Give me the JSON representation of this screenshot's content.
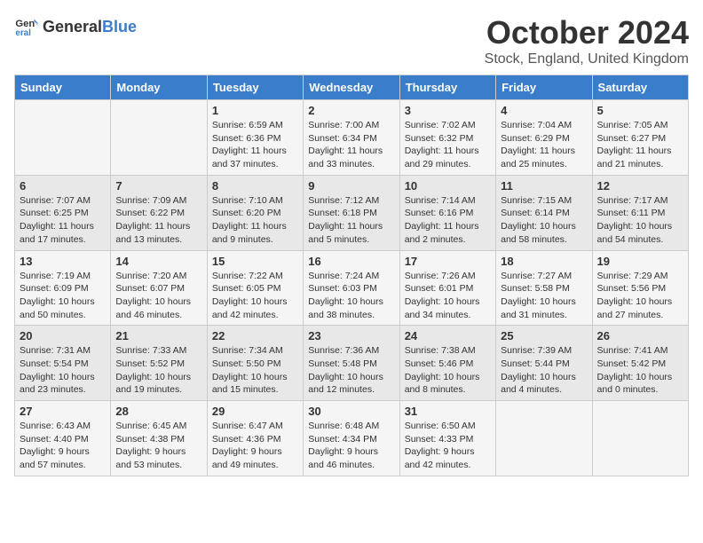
{
  "header": {
    "logo_general": "General",
    "logo_blue": "Blue",
    "month_title": "October 2024",
    "location": "Stock, England, United Kingdom"
  },
  "weekdays": [
    "Sunday",
    "Monday",
    "Tuesday",
    "Wednesday",
    "Thursday",
    "Friday",
    "Saturday"
  ],
  "weeks": [
    [
      {
        "day": "",
        "info": ""
      },
      {
        "day": "",
        "info": ""
      },
      {
        "day": "1",
        "info": "Sunrise: 6:59 AM\nSunset: 6:36 PM\nDaylight: 11 hours and 37 minutes."
      },
      {
        "day": "2",
        "info": "Sunrise: 7:00 AM\nSunset: 6:34 PM\nDaylight: 11 hours and 33 minutes."
      },
      {
        "day": "3",
        "info": "Sunrise: 7:02 AM\nSunset: 6:32 PM\nDaylight: 11 hours and 29 minutes."
      },
      {
        "day": "4",
        "info": "Sunrise: 7:04 AM\nSunset: 6:29 PM\nDaylight: 11 hours and 25 minutes."
      },
      {
        "day": "5",
        "info": "Sunrise: 7:05 AM\nSunset: 6:27 PM\nDaylight: 11 hours and 21 minutes."
      }
    ],
    [
      {
        "day": "6",
        "info": "Sunrise: 7:07 AM\nSunset: 6:25 PM\nDaylight: 11 hours and 17 minutes."
      },
      {
        "day": "7",
        "info": "Sunrise: 7:09 AM\nSunset: 6:22 PM\nDaylight: 11 hours and 13 minutes."
      },
      {
        "day": "8",
        "info": "Sunrise: 7:10 AM\nSunset: 6:20 PM\nDaylight: 11 hours and 9 minutes."
      },
      {
        "day": "9",
        "info": "Sunrise: 7:12 AM\nSunset: 6:18 PM\nDaylight: 11 hours and 5 minutes."
      },
      {
        "day": "10",
        "info": "Sunrise: 7:14 AM\nSunset: 6:16 PM\nDaylight: 11 hours and 2 minutes."
      },
      {
        "day": "11",
        "info": "Sunrise: 7:15 AM\nSunset: 6:14 PM\nDaylight: 10 hours and 58 minutes."
      },
      {
        "day": "12",
        "info": "Sunrise: 7:17 AM\nSunset: 6:11 PM\nDaylight: 10 hours and 54 minutes."
      }
    ],
    [
      {
        "day": "13",
        "info": "Sunrise: 7:19 AM\nSunset: 6:09 PM\nDaylight: 10 hours and 50 minutes."
      },
      {
        "day": "14",
        "info": "Sunrise: 7:20 AM\nSunset: 6:07 PM\nDaylight: 10 hours and 46 minutes."
      },
      {
        "day": "15",
        "info": "Sunrise: 7:22 AM\nSunset: 6:05 PM\nDaylight: 10 hours and 42 minutes."
      },
      {
        "day": "16",
        "info": "Sunrise: 7:24 AM\nSunset: 6:03 PM\nDaylight: 10 hours and 38 minutes."
      },
      {
        "day": "17",
        "info": "Sunrise: 7:26 AM\nSunset: 6:01 PM\nDaylight: 10 hours and 34 minutes."
      },
      {
        "day": "18",
        "info": "Sunrise: 7:27 AM\nSunset: 5:58 PM\nDaylight: 10 hours and 31 minutes."
      },
      {
        "day": "19",
        "info": "Sunrise: 7:29 AM\nSunset: 5:56 PM\nDaylight: 10 hours and 27 minutes."
      }
    ],
    [
      {
        "day": "20",
        "info": "Sunrise: 7:31 AM\nSunset: 5:54 PM\nDaylight: 10 hours and 23 minutes."
      },
      {
        "day": "21",
        "info": "Sunrise: 7:33 AM\nSunset: 5:52 PM\nDaylight: 10 hours and 19 minutes."
      },
      {
        "day": "22",
        "info": "Sunrise: 7:34 AM\nSunset: 5:50 PM\nDaylight: 10 hours and 15 minutes."
      },
      {
        "day": "23",
        "info": "Sunrise: 7:36 AM\nSunset: 5:48 PM\nDaylight: 10 hours and 12 minutes."
      },
      {
        "day": "24",
        "info": "Sunrise: 7:38 AM\nSunset: 5:46 PM\nDaylight: 10 hours and 8 minutes."
      },
      {
        "day": "25",
        "info": "Sunrise: 7:39 AM\nSunset: 5:44 PM\nDaylight: 10 hours and 4 minutes."
      },
      {
        "day": "26",
        "info": "Sunrise: 7:41 AM\nSunset: 5:42 PM\nDaylight: 10 hours and 0 minutes."
      }
    ],
    [
      {
        "day": "27",
        "info": "Sunrise: 6:43 AM\nSunset: 4:40 PM\nDaylight: 9 hours and 57 minutes."
      },
      {
        "day": "28",
        "info": "Sunrise: 6:45 AM\nSunset: 4:38 PM\nDaylight: 9 hours and 53 minutes."
      },
      {
        "day": "29",
        "info": "Sunrise: 6:47 AM\nSunset: 4:36 PM\nDaylight: 9 hours and 49 minutes."
      },
      {
        "day": "30",
        "info": "Sunrise: 6:48 AM\nSunset: 4:34 PM\nDaylight: 9 hours and 46 minutes."
      },
      {
        "day": "31",
        "info": "Sunrise: 6:50 AM\nSunset: 4:33 PM\nDaylight: 9 hours and 42 minutes."
      },
      {
        "day": "",
        "info": ""
      },
      {
        "day": "",
        "info": ""
      }
    ]
  ]
}
